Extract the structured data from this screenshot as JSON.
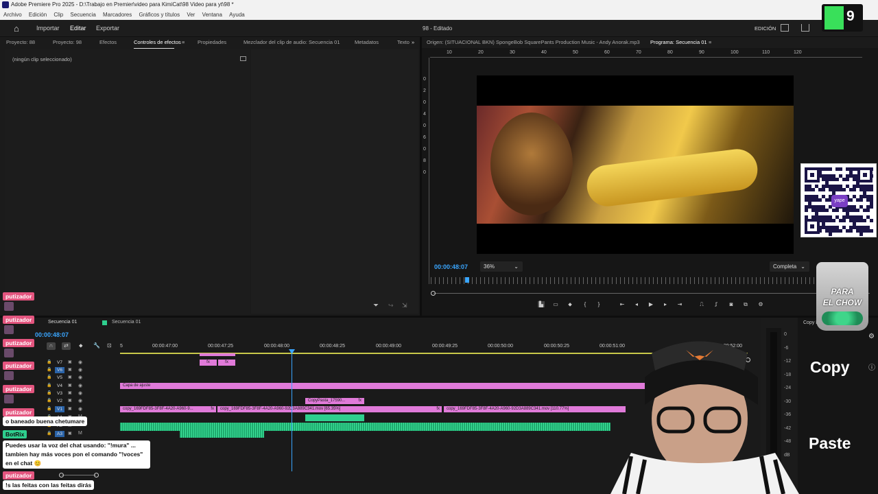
{
  "window": {
    "title": "Adobe Premiere Pro 2025 - D:\\Trabajo en Premier\\video para KimiCat\\98 Video para yt\\98 *"
  },
  "menu": [
    "Archivo",
    "Edición",
    "Clip",
    "Secuencia",
    "Marcadores",
    "Gráficos y títulos",
    "Ver",
    "Ventana",
    "Ayuda"
  ],
  "header": {
    "nav": [
      "Importar",
      "Editar",
      "Exportar"
    ],
    "active": "Editar",
    "project_title": "98 - Editado",
    "workspace": "EDICIÓN"
  },
  "left_tabs": [
    "Proyecto: 88",
    "Proyecto: 98",
    "Efectos",
    "Controles de efectos",
    "Propiedades",
    "Mezclador del clip de audio: Secuencia 01",
    "Metadatos",
    "Texto"
  ],
  "left_active_tab": "Controles de efectos",
  "effects_panel": {
    "empty_text": "(ningún clip seleccionado)"
  },
  "source_tab": "Origen: (SITUACIONAL BKN) SpongeBob SquarePants Production Music - Andy Anorak.mp3",
  "program_tab": "Programa: Secuencia 01",
  "program": {
    "timecode": "00:00:48:07",
    "zoom": "36%",
    "quality": "Completa"
  },
  "ruler_top": [
    "10",
    "20",
    "30",
    "40",
    "50",
    "60",
    "70",
    "80",
    "90",
    "100",
    "110",
    "120"
  ],
  "ruler_left": [
    "0",
    "2",
    "0",
    "4",
    "0",
    "6",
    "0",
    "8",
    "0"
  ],
  "timeline": {
    "tabs": [
      "Secuencia 01",
      "Secuencia 01"
    ],
    "timecode": "00:00:48:07",
    "times": [
      "5",
      "00:00:47:00",
      "00:00:47:25",
      "00:00:48:00",
      "00:00:48:25",
      "00:00:49:00",
      "00:00:49:25",
      "00:00:50:00",
      "00:00:50:25",
      "00:00:51:00",
      "00:00:52:00"
    ],
    "tracks": [
      "V7",
      "V6",
      "V5",
      "V4",
      "V3",
      "V2",
      "V1",
      "A1",
      "A2",
      "A3"
    ],
    "clips": {
      "adjust": "Capa de ajuste",
      "copypasta": "CopyPasta_17590...",
      "v1a": "copy_169FDF85-3F8F-4A20-A960-9...",
      "v1b": "copy_169FDF85-3F8F-4A20-A960-92D3A889C341.mov [65.35%]",
      "v1c": "copy_169FDF85-3F8F-4A20-A960-92D3A889C341.mov [110.77%]",
      "fx": "fx"
    }
  },
  "meter_labels": [
    "0",
    "-6",
    "-12",
    "-18",
    "-24",
    "-30",
    "-36",
    "-42",
    "-48",
    "dB"
  ],
  "chat": [
    {
      "name": "putizador",
      "msg": ""
    },
    {
      "name": "putizador",
      "msg": ""
    },
    {
      "name": "putizador",
      "msg": ""
    },
    {
      "name": "putizador",
      "msg": ""
    },
    {
      "name": "putizador",
      "msg": ""
    },
    {
      "name": "putizador",
      "msg": "o baneado buena chetumare"
    },
    {
      "name": "BotRix",
      "msg": "Puedes usar la voz del chat usando: \"!mura\" ... tambien hay más voces pon el comando \"!voces\" en el chat 😊"
    },
    {
      "name": "putizador",
      "msg": "!s las feitas con las feitas dirás"
    }
  ],
  "overlay": {
    "copy": "Copy",
    "paste": "Paste",
    "copy_panel_tab": "Copy P",
    "jar_line1": "PARA",
    "jar_line2": "EL CHOW",
    "logo_letter": "9",
    "qr_label": "yape"
  },
  "colors": {
    "accent": "#3aa6ff",
    "clip_video": "#e07ad9",
    "clip_audio": "#2ecf8e",
    "chat_name": "#e4557f"
  }
}
